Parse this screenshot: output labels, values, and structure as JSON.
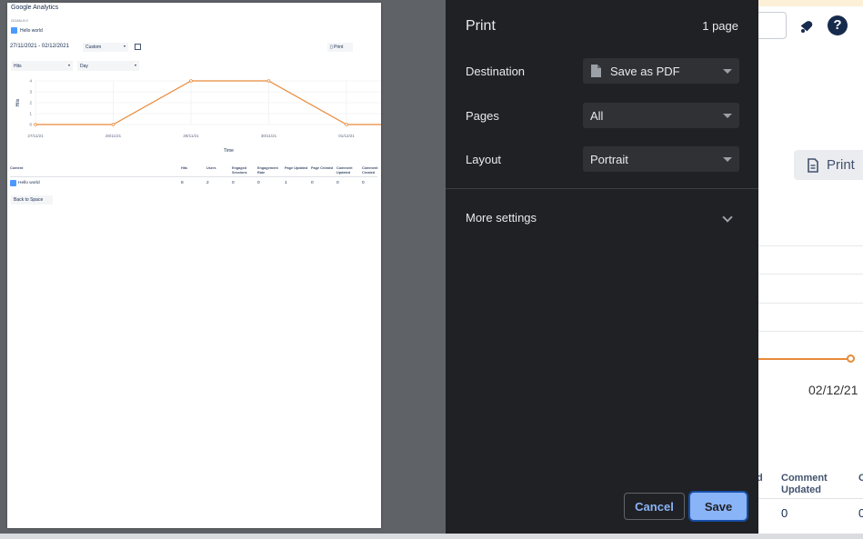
{
  "background_page": {
    "print_button_label": "Print",
    "help_icon_glyph": "?",
    "chart_last_date": "02/12/21",
    "column_partial_left": "d",
    "column_comment_updated": "Comment Updated",
    "column_partial_right": "C",
    "row_value_comment_updated": "0",
    "row_value_partial_right": "0"
  },
  "preview": {
    "app_title": "Google Analytics",
    "app_version": "GOAN-9.0",
    "page_name": "Hello world",
    "date_range": "27/11/2021 - 02/12/2021",
    "range_select": "Custom",
    "print_label": "Print",
    "metric_select": "Hits",
    "interval_select": "Day",
    "y_axis_label": "Hits",
    "x_axis_label": "Time",
    "table_headers": [
      "Content",
      "Hits",
      "Users",
      "Engaged Sessions",
      "Engagement Rate",
      "Page Updated",
      "Page Created",
      "Comment Updated",
      "Comment Created"
    ],
    "table_row": [
      "Hello world",
      "8",
      "2",
      "0",
      "0",
      "1",
      "0",
      "0",
      "0"
    ],
    "back_button": "Back to Space"
  },
  "chart_data": {
    "type": "line",
    "title": "",
    "xlabel": "Time",
    "ylabel": "Hits",
    "x_tick_labels": [
      "27/11/21",
      "28/11/21",
      "29/11/21",
      "30/11/21",
      "01/12/21"
    ],
    "y_tick_labels": [
      "0",
      "1",
      "2",
      "3",
      "4"
    ],
    "ylim": [
      0,
      4
    ],
    "series": [
      {
        "values": [
          0,
          0,
          4,
          4,
          0
        ]
      }
    ],
    "color": "#e88a3a",
    "grid": true
  },
  "print_dialog": {
    "title": "Print",
    "page_count": "1 page",
    "destination_label": "Destination",
    "destination_value": "Save as PDF",
    "pages_label": "Pages",
    "pages_value": "All",
    "layout_label": "Layout",
    "layout_value": "Portrait",
    "more_settings_label": "More settings",
    "cancel_label": "Cancel",
    "save_label": "Save"
  }
}
